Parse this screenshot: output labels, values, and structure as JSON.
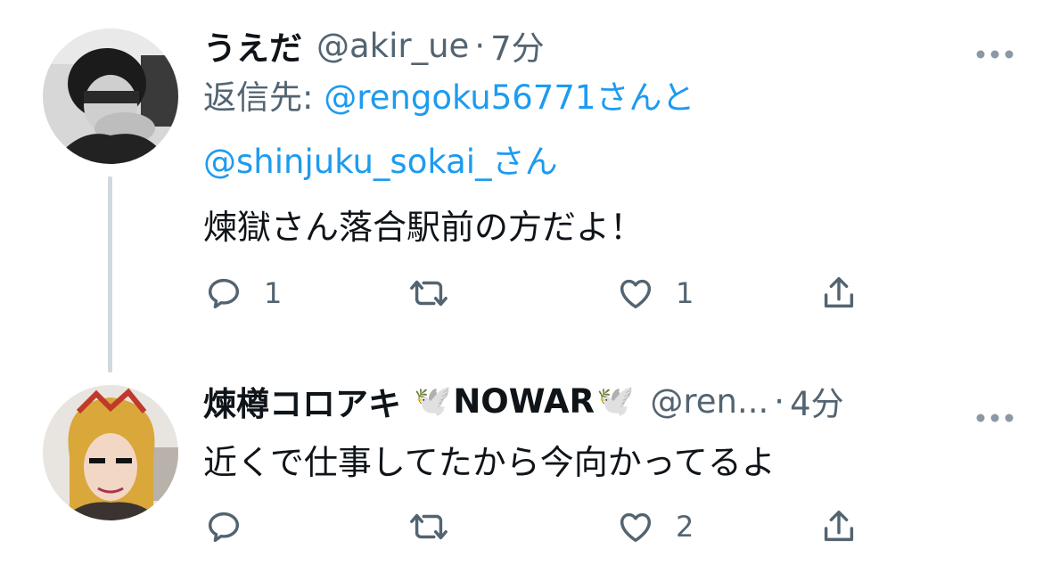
{
  "colors": {
    "link": "#1d9bf0",
    "secondary_text": "#536471",
    "thread_line": "#cfd9de"
  },
  "tweets": [
    {
      "display_name": "うえだ",
      "handle": "@akir_ue",
      "separator": "·",
      "time": "7分",
      "more_icon": "more-horizontal-icon",
      "reply_prefix": "返信先: ",
      "reply_user1": "@rengoku56771",
      "reply_joiner": "さんと",
      "reply_user2": "@shinjuku_sokai_",
      "reply_suffix": "さん",
      "text": "煉獄さん落合駅前の方だよ！",
      "reply_count": "1",
      "retweet_count": "",
      "like_count": "1"
    },
    {
      "display_name_main": "煉樽コロアキ",
      "name_emoji1": "🕊️",
      "display_name_tag": "NOWAR",
      "name_emoji2": "🕊️",
      "handle": "@ren...",
      "separator": "·",
      "time": "4分",
      "more_icon": "more-horizontal-icon",
      "text": "近くで仕事してたから今向かってるよ",
      "reply_count": "",
      "retweet_count": "",
      "like_count": "2"
    }
  ]
}
